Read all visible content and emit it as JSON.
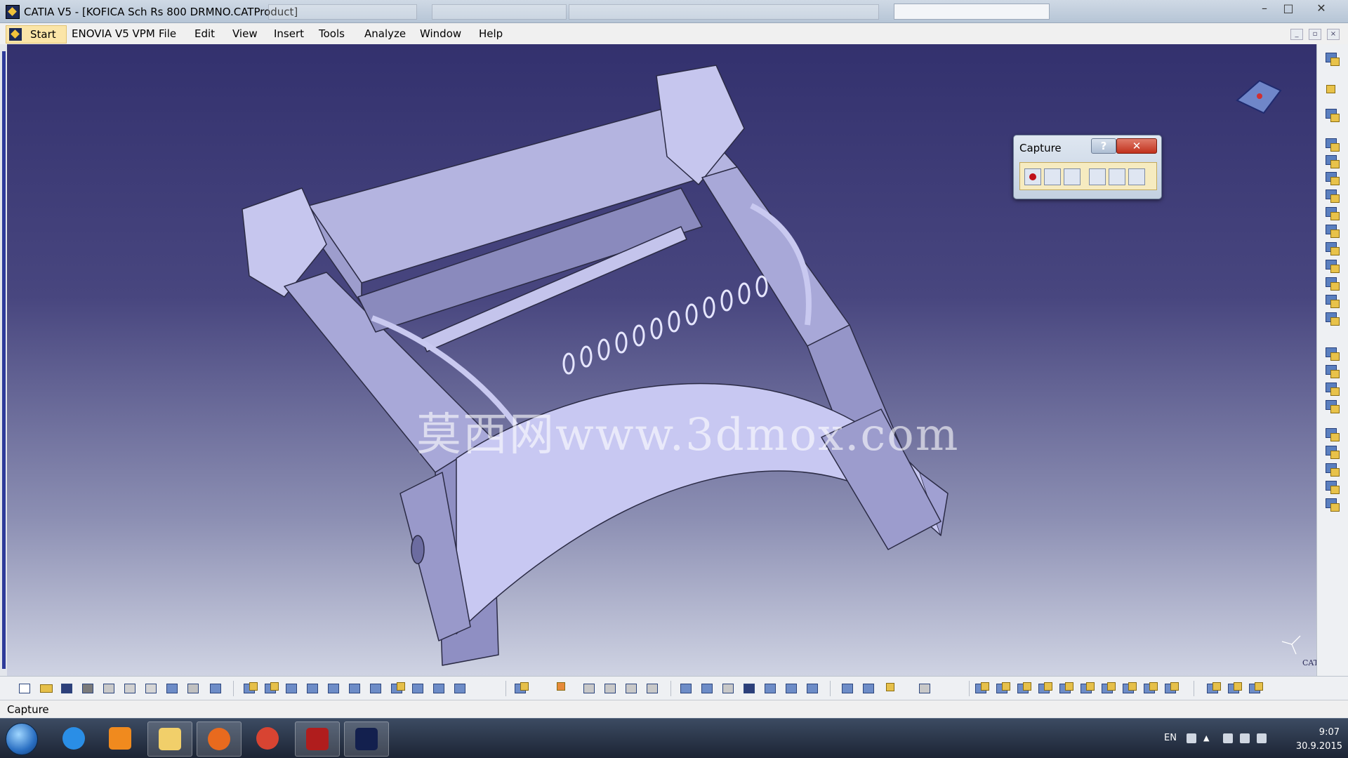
{
  "window": {
    "title": "CATIA V5 - [KOFICA Sch Rs 800 DRMNO.CATProduct]",
    "controls": {
      "minimize": "–",
      "maximize": "□",
      "close": "✕"
    }
  },
  "menubar": {
    "start": "Start",
    "items": [
      "ENOVIA V5 VPM",
      "File",
      "Edit",
      "View",
      "Insert",
      "Tools",
      "Analyze",
      "Window",
      "Help"
    ]
  },
  "viewport": {
    "watermark": "莫西网www.3dmox.com",
    "model": "folding bracket assembly with curved guard plate, rods and springs"
  },
  "capture_dialog": {
    "title": "Capture",
    "help": "?",
    "close": "✕",
    "tools": [
      "record-icon",
      "select-icon",
      "options-icon",
      "capture-3d-icon",
      "album-icon",
      "mode-icon"
    ]
  },
  "statusbar": {
    "text": "Capture"
  },
  "taskbar": {
    "apps": [
      "ie-icon",
      "media-player-icon",
      "explorer-icon",
      "firefox-icon",
      "chrome-icon",
      "acrobat-icon",
      "catia-icon"
    ],
    "lang": "EN",
    "time": "9:07",
    "date": "30.9.2015"
  },
  "colors": {
    "viewport_top": "#33316e",
    "viewport_bottom": "#cfd3e3",
    "model_fill": "#b9b9e6",
    "model_edge": "#2b2b45"
  }
}
